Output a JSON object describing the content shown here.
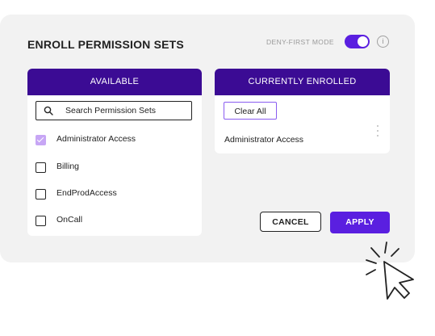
{
  "header": {
    "title": "ENROLL PERMISSION SETS",
    "mode_label": "DENY-FIRST MODE",
    "mode_enabled": true,
    "info_glyph": "i"
  },
  "available": {
    "header": "AVAILABLE",
    "search_placeholder": "Search Permission Sets",
    "items": [
      {
        "label": "Administrator Access",
        "checked": true
      },
      {
        "label": "Billing",
        "checked": false
      },
      {
        "label": "EndProdAccess",
        "checked": false
      },
      {
        "label": "OnCall",
        "checked": false
      }
    ]
  },
  "enrolled": {
    "header": "CURRENTLY ENROLLED",
    "clear_label": "Clear All",
    "items": [
      {
        "label": "Administrator Access"
      }
    ]
  },
  "actions": {
    "cancel_label": "CANCEL",
    "apply_label": "APPLY"
  },
  "colors": {
    "accent": "#5a1fe0",
    "header_bg": "#3b0b94",
    "checked": "#c7a6f5"
  },
  "icons": [
    "search-icon",
    "info-icon",
    "kebab-menu-icon",
    "cursor-click-icon"
  ]
}
